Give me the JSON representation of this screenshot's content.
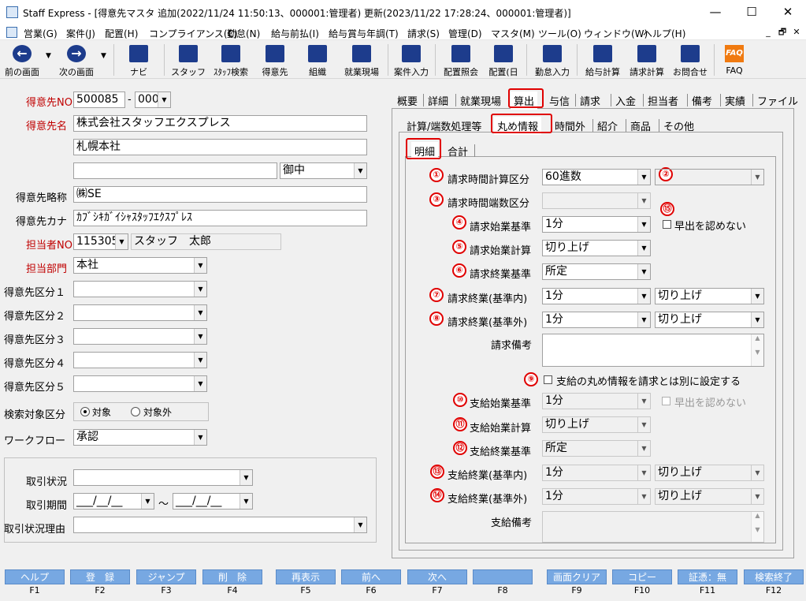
{
  "title": "Staff Express - [得意先マスタ 追加(2022/11/24 11:50:13、000001:管理者) 更新(2023/11/22 17:28:24、000001:管理者)]",
  "window": {
    "min": "—",
    "max": "☐",
    "close": "✕"
  },
  "menu": [
    "営業(G)",
    "案件(J)",
    "配置(H)",
    "コンプライアンス(C)",
    "勤怠(N)",
    "給与前払(I)",
    "給与賞与年調(T)",
    "請求(S)",
    "管理(D)",
    "マスタ(M)",
    "ツール(O)",
    "ウィンドウ(W)",
    "ヘルプ(H)"
  ],
  "mdi": {
    "min": "_",
    "restore": "🗗",
    "close": "✕"
  },
  "toolbar": {
    "prev": "前の画面",
    "next": "次の画面",
    "navi": "ナビ",
    "staff": "スタッフ",
    "staff_search": "ｽﾀｯﾌ検索",
    "customer": "得意先",
    "org": "組織",
    "site": "就業現場",
    "case_input": "案件入力",
    "assign_inquiry": "配置照会",
    "assign": "配置(日",
    "attend_input": "勤怠入力",
    "payroll": "給与計算",
    "billing": "請求計算",
    "contact": "お問合せ",
    "faq": "FAQ",
    "faq_icon": "FAQ"
  },
  "left": {
    "code_label": "得意先NO",
    "code": "500085",
    "code_sub": "000",
    "dash": "-",
    "name_label": "得意先名",
    "name1": "株式会社スタッフエクスプレス",
    "name2": "札幌本社",
    "name3": "",
    "honorific": "御中",
    "abbr_label": "得意先略称",
    "abbr": "㈱SE",
    "kana_label": "得意先カナ",
    "kana": "ｶﾌﾞｼｷｶﾞｲｼｬｽﾀｯﾌｴｸｽﾌﾟﾚｽ",
    "staff_label": "担当者NO",
    "staff_no": "115305",
    "staff_name": "スタッフ　太郎",
    "dept_label": "担当部門",
    "dept": "本社",
    "kubun": [
      {
        "label": "得意先区分１",
        "value": ""
      },
      {
        "label": "得意先区分２",
        "value": ""
      },
      {
        "label": "得意先区分３",
        "value": ""
      },
      {
        "label": "得意先区分４",
        "value": ""
      },
      {
        "label": "得意先区分５",
        "value": ""
      }
    ],
    "search_label": "検索対象区分",
    "search_on": "対象",
    "search_off": "対象外",
    "workflow_label": "ワークフロー",
    "workflow": "承認",
    "trade_status_label": "取引状況",
    "trade_status": "",
    "trade_period_label": "取引期間",
    "date_from": "___/__/__",
    "date_to": "___/__/__",
    "tilde": "～",
    "trade_reason_label": "取引状況理由",
    "trade_reason": ""
  },
  "tabs_main": [
    "概要",
    "詳細",
    "就業現場",
    "算出",
    "与信",
    "請求",
    "入金",
    "担当者",
    "備考",
    "実績",
    "ファイル"
  ],
  "tabs_sub": [
    "計算/端数処理等",
    "丸め情報",
    "時間外",
    "紹介",
    "商品",
    "その他"
  ],
  "tabs_inner": [
    "明細",
    "合計"
  ],
  "rows": {
    "r1": {
      "num": "①",
      "label": "請求時間計算区分",
      "value": "60進数"
    },
    "n2": "②",
    "r3": {
      "num": "③",
      "label": "請求時間端数区分",
      "value": ""
    },
    "r4": {
      "num": "④",
      "label": "請求始業基準",
      "value": "1分"
    },
    "n15": "⑮",
    "early1": "早出を認めない",
    "r5": {
      "num": "⑤",
      "label": "請求始業計算",
      "value": "切り上げ"
    },
    "r6": {
      "num": "⑥",
      "label": "請求終業基準",
      "value": "所定"
    },
    "r7": {
      "num": "⑦",
      "label": "請求終業(基準内)",
      "value": "1分",
      "value2": "切り上げ"
    },
    "r8": {
      "num": "⑧",
      "label": "請求終業(基準外)",
      "value": "1分",
      "value2": "切り上げ"
    },
    "remark_label": "請求備考",
    "r9": {
      "num": "⑨",
      "label": "支給の丸め情報を請求とは別に設定する"
    },
    "r10": {
      "num": "⑩",
      "label": "支給始業基準",
      "value": "1分"
    },
    "early2": "早出を認めない",
    "r11": {
      "num": "⑪",
      "label": "支給始業計算",
      "value": "切り上げ"
    },
    "r12": {
      "num": "⑫",
      "label": "支給終業基準",
      "value": "所定"
    },
    "r13": {
      "num": "⑬",
      "label": "支給終業(基準内)",
      "value": "1分",
      "value2": "切り上げ"
    },
    "r14": {
      "num": "⑭",
      "label": "支給終業(基準外)",
      "value": "1分",
      "value2": "切り上げ"
    },
    "pay_remark_label": "支給備考"
  },
  "fkeys": [
    {
      "label": "ヘルプ",
      "key": "F1"
    },
    {
      "label": "登　録",
      "key": "F2"
    },
    {
      "label": "ジャンプ",
      "key": "F3"
    },
    {
      "label": "削　除",
      "key": "F4"
    },
    {
      "label": "再表示",
      "key": "F5"
    },
    {
      "label": "前へ",
      "key": "F6"
    },
    {
      "label": "次へ",
      "key": "F7"
    },
    {
      "label": "",
      "key": "F8"
    },
    {
      "label": "画面クリア",
      "key": "F9"
    },
    {
      "label": "コピー",
      "key": "F10"
    },
    {
      "label": "証憑：無",
      "key": "F11"
    },
    {
      "label": "検索終了",
      "key": "F12"
    }
  ],
  "colors": {
    "accent_red": "#e00000",
    "fkey_blue": "#77a8e2",
    "toolbar_icon": "#1d3c8c"
  }
}
